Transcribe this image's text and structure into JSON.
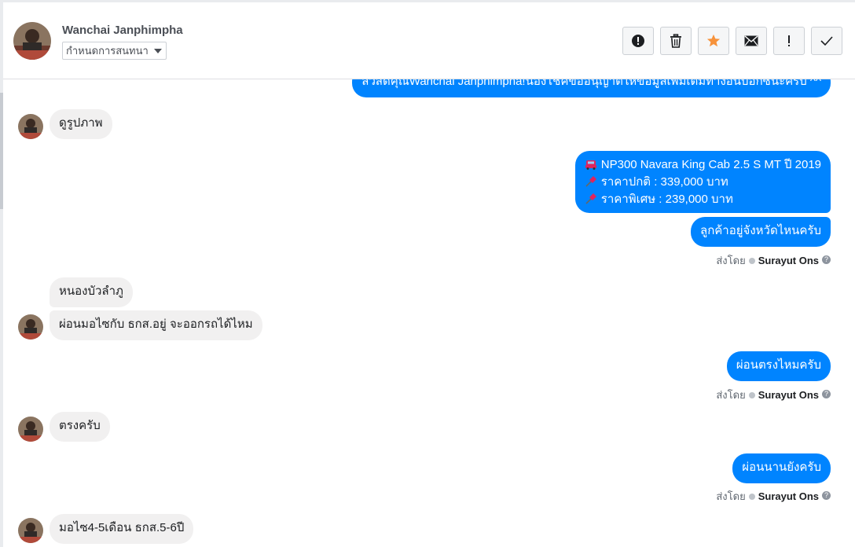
{
  "header": {
    "contact_name": "Wanchai Janphimpha",
    "label_select": "กำหนดการสนทนา",
    "actions": [
      {
        "name": "spam-button",
        "icon": "exclamation-circle-icon"
      },
      {
        "name": "delete-button",
        "icon": "trash-icon"
      },
      {
        "name": "star-button",
        "icon": "star-icon"
      },
      {
        "name": "mark-unread-button",
        "icon": "envelope-icon"
      },
      {
        "name": "priority-button",
        "icon": "exclamation-icon"
      },
      {
        "name": "done-button",
        "icon": "checkmark-icon"
      }
    ]
  },
  "colors": {
    "outgoing": "#0084ff",
    "incoming": "#f1f0f0",
    "star": "#f7923a"
  },
  "messages": {
    "greeting": "สวัสดีคุณWanchai Janphimpha!น้องโชคขออนุญาติให้ข้อมูลเพิ่มเติมทางอินบ็อกซ์นะครับ ^^",
    "in_1": "ดูรูปภาพ",
    "offer_line_1": "NP300 Navara King Cab 2.5 S MT ปี 2019",
    "offer_line_2": "ราคาปกติ : 339,000 บาท",
    "offer_line_3": "ราคาพิเศษ : 239,000 บาท",
    "out_province": "ลูกค้าอยู่จังหวัดไหนครับ",
    "in_2": "หนองบัวลำภู",
    "in_3": "ผ่อนมอไซกับ ธกส.อยู่ จะออกรถได้ไหม",
    "out_straight": "ผ่อนตรงไหมครับ",
    "in_4": "ตรงครับ",
    "out_long": "ผ่อนนานยังครับ",
    "in_5": "มอไซ4-5เดือน ธกส.5-6ปี"
  },
  "sent_by": {
    "label": "ส่งโดย",
    "agent": "Surayut Ons"
  }
}
